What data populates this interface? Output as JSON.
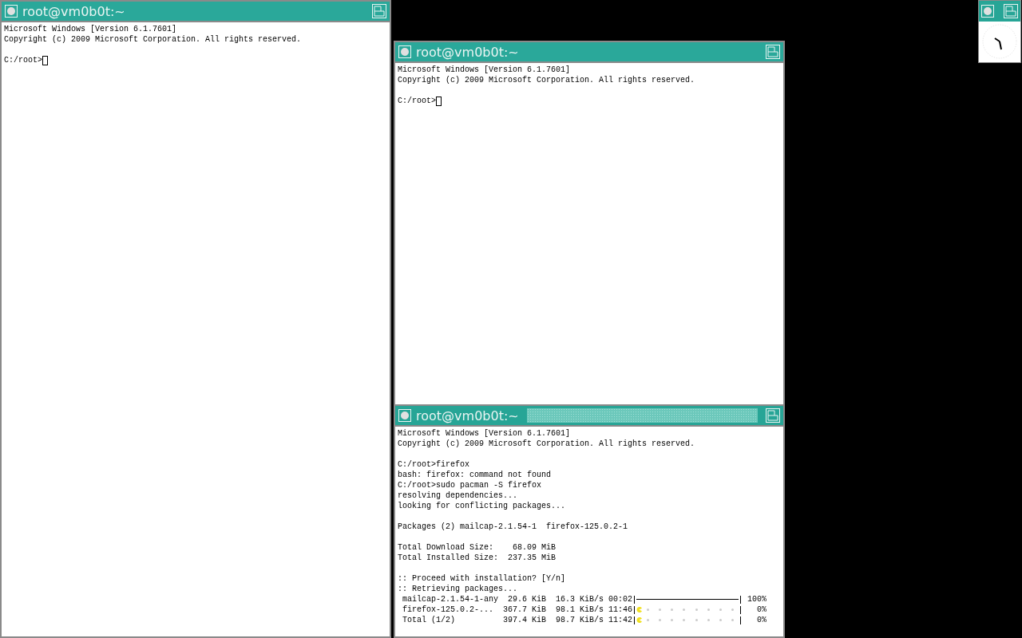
{
  "windows": [
    {
      "title": "root@vm0b0t:~",
      "active": false,
      "blocks": [
        [
          "Microsoft Windows [Version 6.1.7601]",
          "Copyright (c) 2009 Microsoft Corporation. All rights reserved."
        ],
        [
          "C:/root>"
        ]
      ],
      "cursor": true
    },
    {
      "title": "root@vm0b0t:~",
      "active": false,
      "blocks": [
        [
          "Microsoft Windows [Version 6.1.7601]",
          "Copyright (c) 2009 Microsoft Corporation. All rights reserved."
        ],
        [
          "C:/root>"
        ]
      ],
      "cursor": true
    },
    {
      "title": "root@vm0b0t:~",
      "active": true,
      "blocks": [
        [
          "Microsoft Windows [Version 6.1.7601]",
          "Copyright (c) 2009 Microsoft Corporation. All rights reserved."
        ],
        [
          "C:/root>firefox",
          "bash: firefox: command not found",
          "C:/root>sudo pacman -S firefox",
          "resolving dependencies...",
          "looking for conflicting packages..."
        ],
        [
          "Packages (2) mailcap-2.1.54-1  firefox-125.0.2-1"
        ],
        [
          "Total Download Size:    68.09 MiB",
          "Total Installed Size:  237.35 MiB"
        ],
        [
          ":: Proceed with installation? [Y/n]",
          ":: Retrieving packages..."
        ]
      ],
      "cursor": false,
      "progress": [
        {
          "name": "mailcap-2.1.54-1-any",
          "size": "29.6 KiB",
          "speed": "16.3 KiB/s",
          "eta": "00:02",
          "level": 1,
          "percent": "100%"
        },
        {
          "name": "firefox-125.0.2-...",
          "size": "367.7 KiB",
          "speed": "98.1 KiB/s",
          "eta": "11:46",
          "level": 0,
          "percent": "0%"
        },
        {
          "name": "Total (1/2)",
          "size": "397.4 KiB",
          "speed": "98.7 KiB/s",
          "eta": "11:42",
          "level": 0,
          "percent": "0%"
        }
      ]
    }
  ]
}
